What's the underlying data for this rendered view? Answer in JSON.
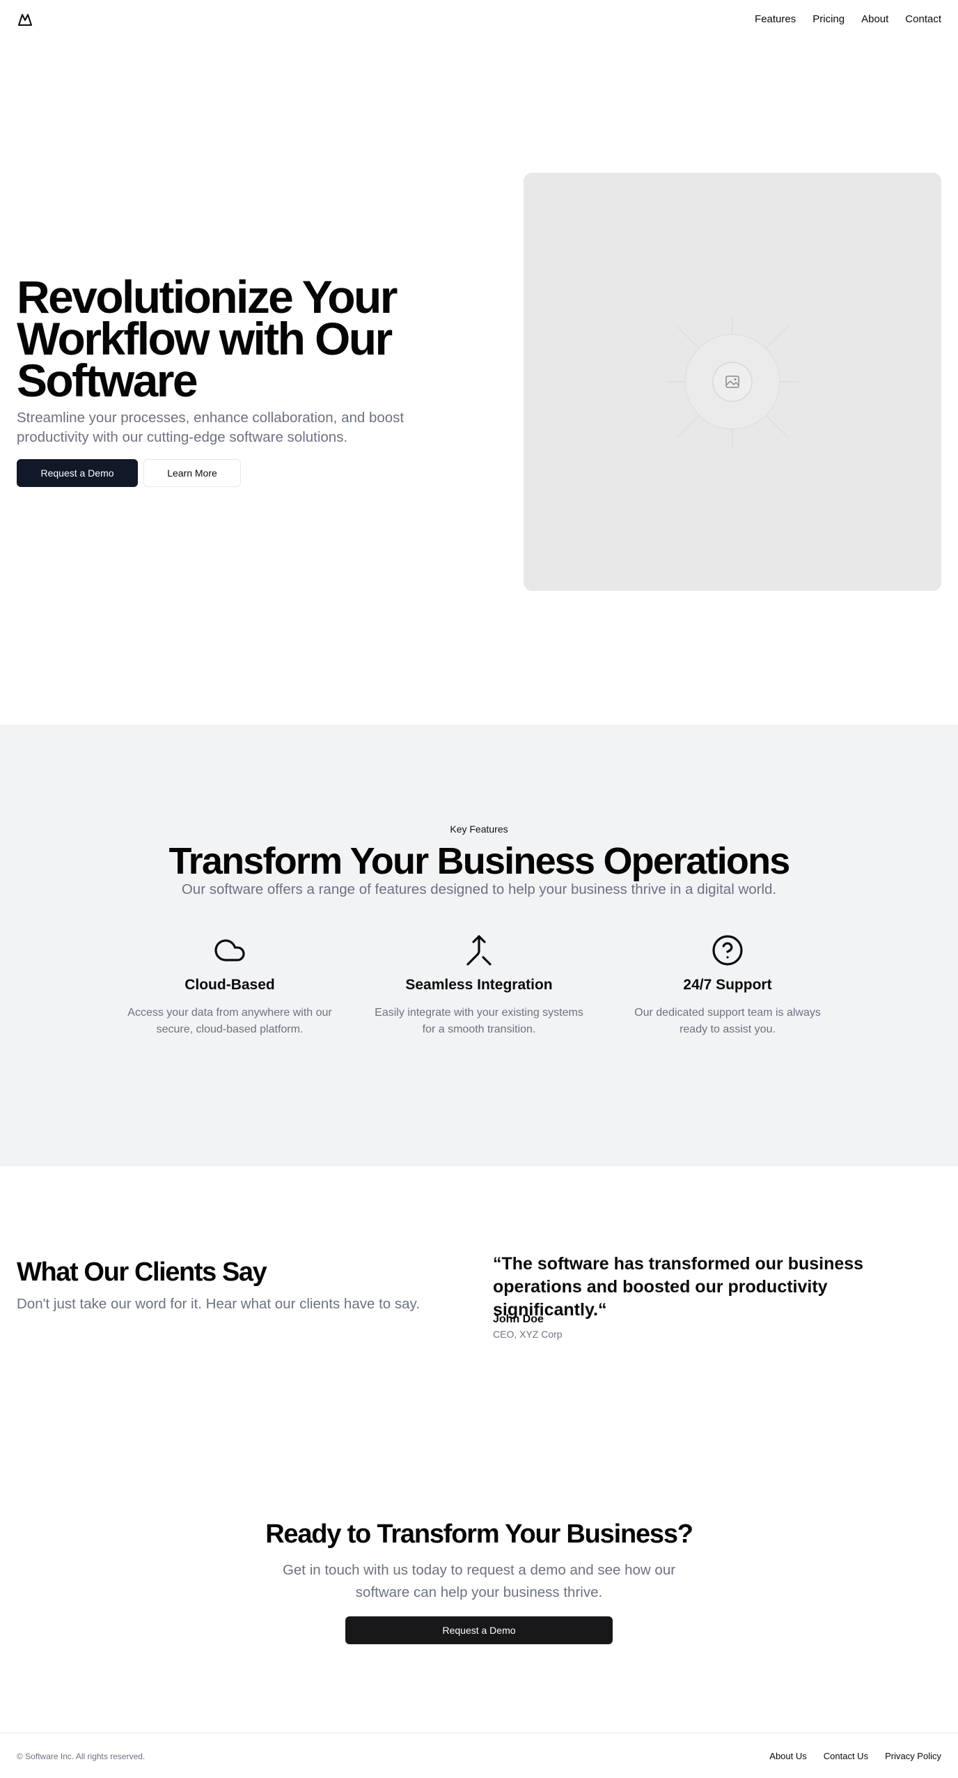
{
  "header": {
    "logo_icon": "mountain-icon",
    "nav": [
      {
        "label": "Features"
      },
      {
        "label": "Pricing"
      },
      {
        "label": "About"
      },
      {
        "label": "Contact"
      }
    ]
  },
  "hero": {
    "title": "Revolutionize Your Workflow with Our Software",
    "subtitle": "Streamline your processes, enhance collaboration, and boost productivity with our cutting-edge software solutions.",
    "primary_button": "Request a Demo",
    "secondary_button": "Learn More",
    "image_icon": "image-placeholder-icon"
  },
  "features": {
    "eyebrow": "Key Features",
    "title": "Transform Your Business Operations",
    "subtitle": "Our software offers a range of features designed to help your business thrive in a digital world.",
    "items": [
      {
        "icon": "cloud-icon",
        "title": "Cloud-Based",
        "description": "Access your data from anywhere with our secure, cloud-based platform."
      },
      {
        "icon": "merge-icon",
        "title": "Seamless Integration",
        "description": "Easily integrate with your existing systems for a smooth transition."
      },
      {
        "icon": "help-circle-icon",
        "title": "24/7 Support",
        "description": "Our dedicated support team is always ready to assist you."
      }
    ]
  },
  "testimonials": {
    "title": "What Our Clients Say",
    "subtitle": "Don't just take our word for it. Hear what our clients have to say.",
    "quote": "“The software has transformed our business operations and boosted our productivity significantly.“",
    "name": "John Doe",
    "role": "CEO, XYZ Corp"
  },
  "cta": {
    "title": "Ready to Transform Your Business?",
    "subtitle": "Get in touch with us today to request a demo and see how our software can help your business thrive.",
    "button": "Request a Demo"
  },
  "footer": {
    "copyright": "© Software Inc. All rights reserved.",
    "links": [
      {
        "label": "About Us"
      },
      {
        "label": "Contact Us"
      },
      {
        "label": "Privacy Policy"
      }
    ]
  },
  "colors": {
    "primary_button": "#111827",
    "cta_button": "#18181b",
    "muted_text": "#6b7280",
    "features_bg": "#f2f3f5",
    "placeholder_bg": "#e8e8e8"
  }
}
